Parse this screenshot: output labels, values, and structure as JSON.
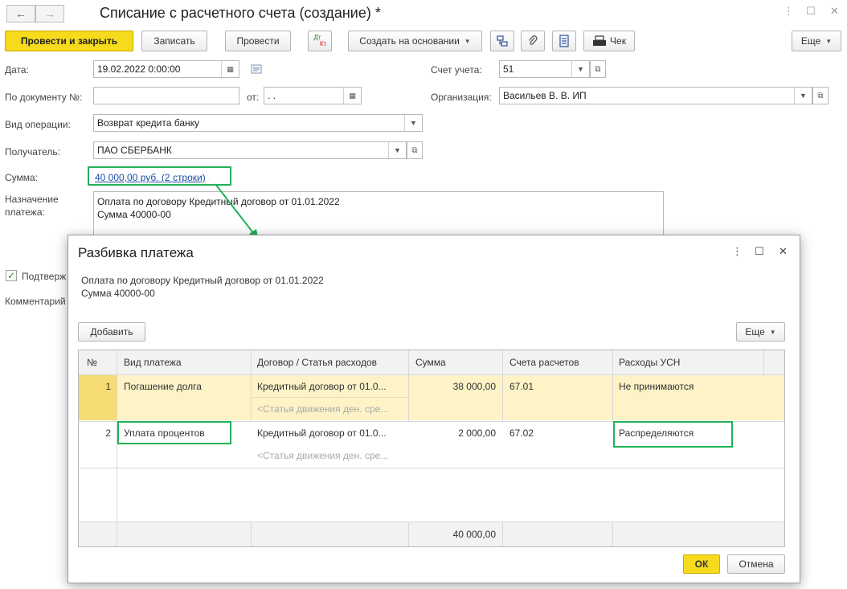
{
  "window": {
    "title": "Списание с расчетного счета (создание) *",
    "nav_back": "←",
    "nav_forward": "→",
    "menu_glyph": "⋮",
    "maximize_glyph": "☐",
    "close_glyph": "✕"
  },
  "toolbar": {
    "post_close": "Провести и закрыть",
    "save": "Записать",
    "post": "Провести",
    "dtkt_top": "Дт",
    "dtkt_bottom": "Кт",
    "create_based": "Создать на основании",
    "check_label": "Чек",
    "more": "Еще"
  },
  "form": {
    "date_label": "Дата:",
    "date_value": "19.02.2022  0:00:00",
    "doc_no_label": "По документу №:",
    "doc_no_value": "",
    "from_label": "от:",
    "from_value": "  .  .",
    "account_label": "Счет учета:",
    "account_value": "51",
    "org_label": "Организация:",
    "org_value": "Васильев В. В. ИП",
    "operation_label": "Вид операции:",
    "operation_value": "Возврат кредита банку",
    "recipient_label": "Получатель:",
    "recipient_value": "ПАО СБЕРБАНК",
    "sum_label": "Сумма:",
    "sum_link": "40 000,00 руб. (2 строки)",
    "purpose_label_1": "Назначение",
    "purpose_label_2": "платежа:",
    "purpose_line_1": "Оплата по договору Кредитный договор от 01.01.2022",
    "purpose_line_2": "Сумма 40000-00",
    "confirm_label": "Подтверж",
    "comment_label": "Комментарий"
  },
  "dialog": {
    "title": "Разбивка платежа",
    "text_line_1": "Оплата по договору Кредитный договор от 01.01.2022",
    "text_line_2": "Сумма 40000-00",
    "add_button": "Добавить",
    "more_button": "Еще",
    "ok_button": "ОК",
    "cancel_button": "Отмена",
    "columns": [
      "№",
      "Вид платежа",
      "Договор / Статья расходов",
      "Сумма",
      "Счета расчетов",
      "Расходы УСН"
    ],
    "rows": [
      {
        "num": "1",
        "type": "Погашение долга",
        "contract": "Кредитный договор от 01.0...",
        "article": "<Статья движения ден. сре...",
        "sum": "38 000,00",
        "account": "67.01",
        "usn": "Не принимаются"
      },
      {
        "num": "2",
        "type": "Уплата процентов",
        "contract": "Кредитный договор от 01.0...",
        "article": "<Статья движения ден. сре...",
        "sum": "2 000,00",
        "account": "67.02",
        "usn": "Распределяются"
      }
    ],
    "total": "40 000,00"
  },
  "colors": {
    "highlight": "#1fb254",
    "primary_button": "#f6da1c",
    "selected_row": "#fdf3c7",
    "link": "#1c4fa6"
  }
}
